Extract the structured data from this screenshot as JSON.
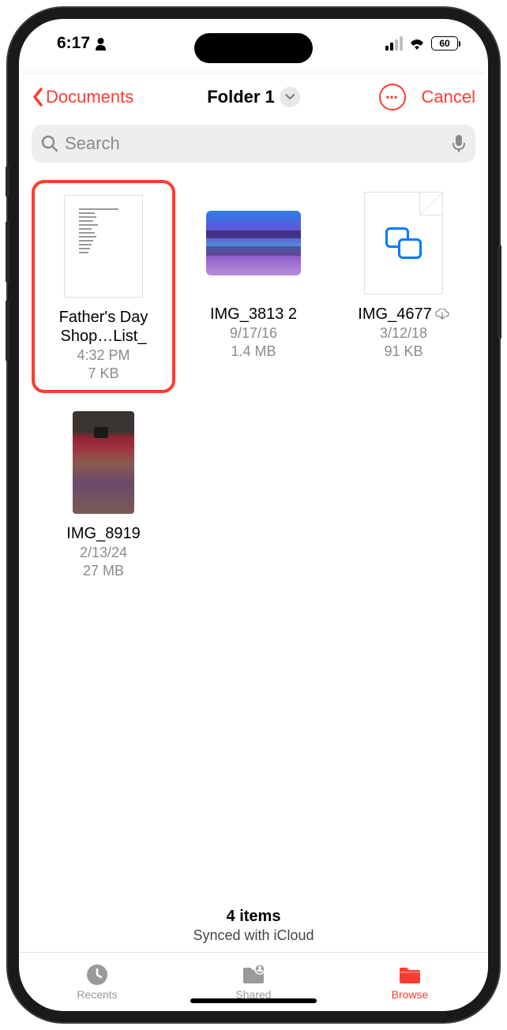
{
  "status": {
    "time": "6:17",
    "battery": "60"
  },
  "nav": {
    "back_label": "Documents",
    "title": "Folder 1",
    "cancel_label": "Cancel"
  },
  "search": {
    "placeholder": "Search"
  },
  "files": [
    {
      "name": "Father's Day Shop…List_",
      "meta1": "4:32 PM",
      "meta2": "7 KB",
      "highlighted": true,
      "type": "doc",
      "cloud": false
    },
    {
      "name": "IMG_3813 2",
      "meta1": "9/17/16",
      "meta2": "1.4 MB",
      "highlighted": false,
      "type": "sky",
      "cloud": false
    },
    {
      "name": "IMG_4677",
      "meta1": "3/12/18",
      "meta2": "91 KB",
      "highlighted": false,
      "type": "page",
      "cloud": true
    },
    {
      "name": "IMG_8919",
      "meta1": "2/13/24",
      "meta2": "27 MB",
      "highlighted": false,
      "type": "photo",
      "cloud": false
    }
  ],
  "footer": {
    "count": "4 items",
    "sync": "Synced with iCloud"
  },
  "tabs": {
    "recents": "Recents",
    "shared": "Shared",
    "browse": "Browse"
  }
}
